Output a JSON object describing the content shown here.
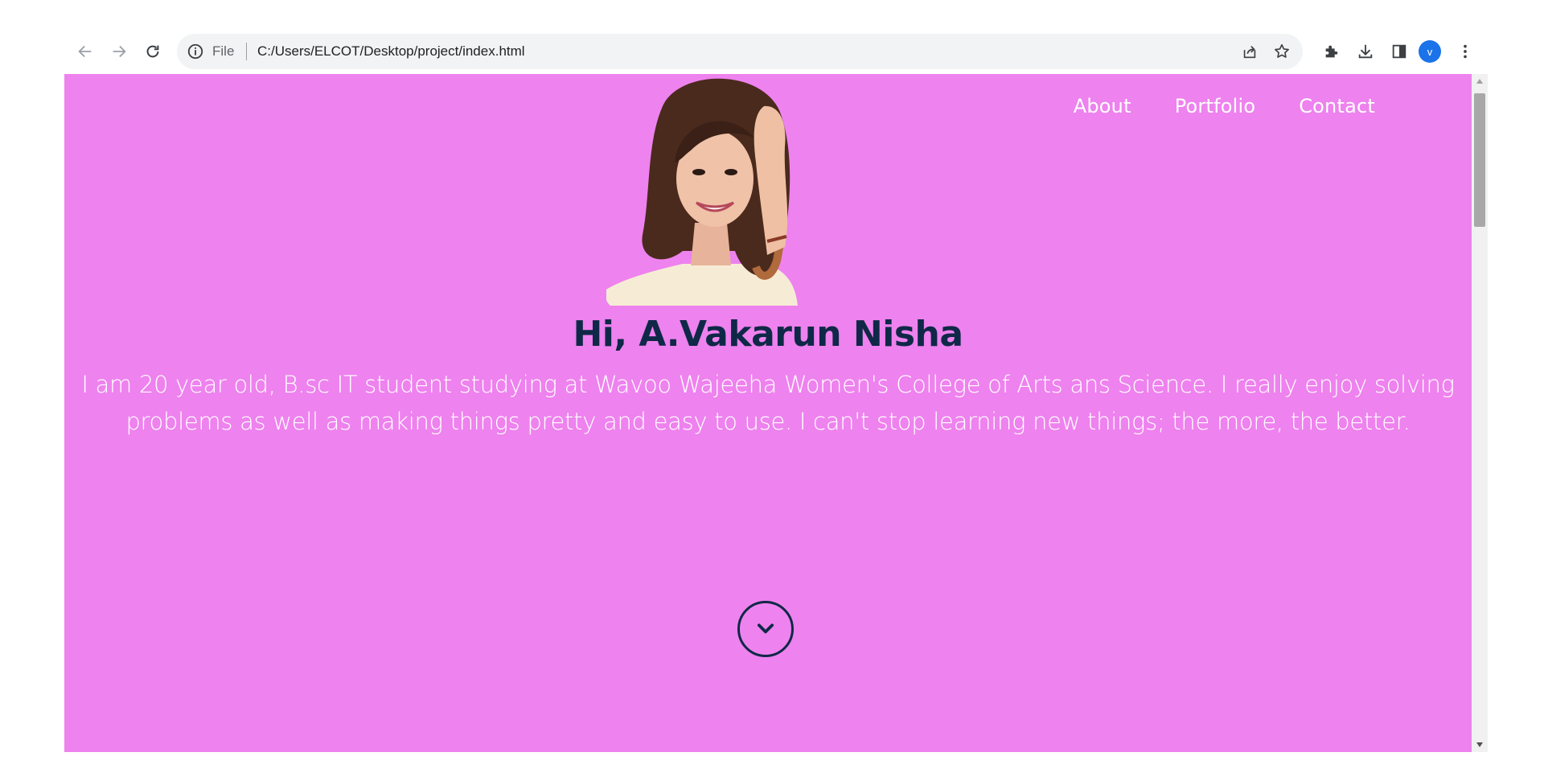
{
  "browser": {
    "address_scheme": "File",
    "address_url": "C:/Users/ELCOT/Desktop/project/index.html",
    "profile_initial": "v",
    "profile_color": "#1a73e8"
  },
  "icons": {
    "back": "arrow-left-icon",
    "forward": "arrow-right-icon",
    "reload": "reload-icon",
    "site_info": "info-icon",
    "share": "share-icon",
    "bookmark": "star-icon",
    "extensions": "puzzle-icon",
    "downloads": "download-icon",
    "side_panel": "side-panel-icon",
    "menu": "kebab-menu-icon",
    "scroll_down": "chevron-down-icon"
  },
  "colors": {
    "page_background": "#ee82ee",
    "heading": "#0f2847",
    "text": "#ffffff",
    "chrome_bg": "#ffffff",
    "omnibox_bg": "#f1f3f4"
  },
  "nav": {
    "items": [
      "About",
      "Portfolio",
      "Contact"
    ]
  },
  "hero": {
    "title": "Hi, A.Vakarun Nisha",
    "description": "I am 20 year old, B.sc IT student studying at Wavoo Wajeeha Women's College of Arts ans Science. I really enjoy solving problems as well as making things pretty and easy to use. I can't stop learning new things; the more, the better."
  }
}
